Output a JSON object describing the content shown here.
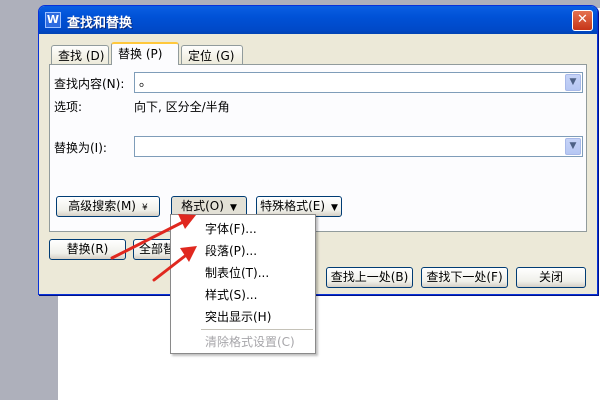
{
  "dialog": {
    "title": "查找和替换",
    "app_icon": "W",
    "close_glyph": "✕",
    "tabs": [
      {
        "label": "查找 (D)"
      },
      {
        "label": "替换 (P)"
      },
      {
        "label": "定位 (G)"
      }
    ],
    "find": {
      "label": "查找内容(N):",
      "value": "。"
    },
    "options": {
      "label": "选项:",
      "value": "向下, 区分全/半角"
    },
    "replace": {
      "label": "替换为(I):",
      "value": ""
    },
    "buttons": {
      "advanced": "高级搜索(M)",
      "format": "格式(O)",
      "special": "特殊格式(E)",
      "replace": "替换(R)",
      "replace_all": "全部替",
      "find_prev": "查找上一处(B)",
      "find_next": "查找下一处(F)",
      "close": "关闭"
    }
  },
  "format_menu": {
    "items": [
      {
        "label": "字体(F)...",
        "enabled": true
      },
      {
        "label": "段落(P)...",
        "enabled": true
      },
      {
        "label": "制表位(T)...",
        "enabled": true
      },
      {
        "label": "样式(S)...",
        "enabled": true
      },
      {
        "label": "突出显示(H)",
        "enabled": true
      },
      {
        "label": "清除格式设置(C)",
        "enabled": false
      }
    ]
  },
  "icons": {
    "combo_arrow": "chevron-down-icon",
    "button_arrow": "triangle-down-icon",
    "advanced_arrow": "double-chevron-down-icon",
    "annotation": "red-arrow-icon"
  },
  "colors": {
    "titlebar": "#0054e3",
    "dialog_bg": "#ece9d8",
    "tab_highlight": "#ffc83c",
    "annotation_arrow": "#e0281f"
  }
}
